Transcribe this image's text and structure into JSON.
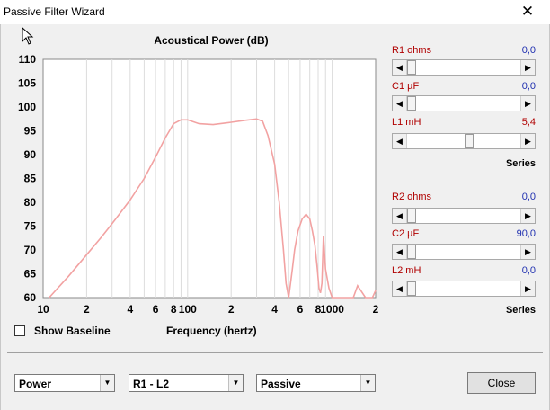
{
  "window": {
    "title": "Passive Filter Wizard"
  },
  "chart": {
    "title": "Acoustical Power (dB)",
    "xlabel": "Frequency (hertz)",
    "y_ticks": [
      "110",
      "105",
      "100",
      "95",
      "90",
      "85",
      "80",
      "75",
      "70",
      "65",
      "60"
    ],
    "x_ticks": [
      "10",
      "2",
      "4",
      "6",
      "8",
      "100",
      "2",
      "4",
      "6",
      "8",
      "1000",
      "2"
    ]
  },
  "chart_data": {
    "type": "line",
    "title": "Acoustical Power (dB)",
    "xlabel": "Frequency (hertz)",
    "ylabel": "",
    "x_scale": "log",
    "xlim": [
      10,
      2000
    ],
    "ylim": [
      60,
      110
    ],
    "grid": true,
    "series": [
      {
        "color": "#f2a2a2",
        "x": [
          11,
          15,
          20,
          25,
          30,
          40,
          50,
          60,
          70,
          80,
          90,
          100,
          120,
          150,
          200,
          250,
          300,
          330,
          360,
          400,
          430,
          460,
          480,
          500,
          510,
          530,
          550,
          580,
          620,
          660,
          700,
          730,
          760,
          790,
          810,
          830,
          850,
          870,
          900,
          950,
          1000,
          1100,
          1200,
          1300,
          1400,
          1500,
          1700,
          1900,
          2000
        ],
        "y": [
          60,
          64.5,
          69,
          72.5,
          75.5,
          80.5,
          85,
          89.5,
          93.5,
          96.5,
          97.3,
          97.3,
          96.5,
          96.3,
          96.8,
          97.2,
          97.5,
          97,
          94,
          88,
          80,
          70,
          63,
          60,
          62,
          66,
          70,
          74,
          76.5,
          77.5,
          76.5,
          74,
          71,
          66,
          62,
          61,
          63,
          73,
          66,
          62,
          60,
          60,
          60,
          60,
          60,
          62.5,
          60,
          60,
          61.5
        ]
      }
    ]
  },
  "controls": {
    "group1": {
      "r1": {
        "label": "R1  ohms",
        "value": "0,0",
        "color": "#2030b0"
      },
      "c1": {
        "label": "C1  µF",
        "value": "0,0",
        "color": "#2030b0"
      },
      "l1": {
        "label": "L1  mH",
        "value": "5,4",
        "color": "#b00000"
      },
      "series_label": "Series"
    },
    "group2": {
      "r2": {
        "label": "R2  ohms",
        "value": "0,0",
        "color": "#2030b0"
      },
      "c2": {
        "label": "C2  µF",
        "value": "90,0",
        "color": "#2030b0"
      },
      "l2": {
        "label": "L2  mH",
        "value": "0,0",
        "color": "#2030b0"
      },
      "series_label": "Series"
    },
    "slider_levels": {
      "r1": 0,
      "c1": 0,
      "l1": 0.45,
      "r2": 0,
      "c2": 0,
      "l2": 0
    }
  },
  "show_baseline": {
    "label": "Show Baseline",
    "checked": false
  },
  "footer": {
    "combo1": "Power",
    "combo2": "R1 - L2",
    "combo3": "Passive",
    "close_label": "Close"
  }
}
